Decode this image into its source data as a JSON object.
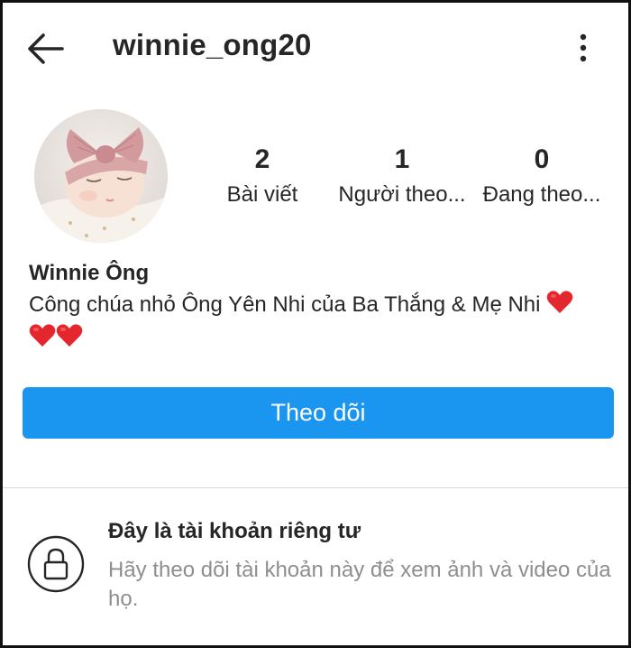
{
  "header": {
    "username": "winnie_ong20",
    "back_icon": "arrow-left-icon",
    "menu_icon": "more-vertical-icon"
  },
  "profile": {
    "avatar": "profile-photo-baby",
    "stats": [
      {
        "value": "2",
        "label": "Bài viết"
      },
      {
        "value": "1",
        "label": "Người theo..."
      },
      {
        "value": "0",
        "label": "Đang theo..."
      }
    ],
    "full_name": "Winnie Ông",
    "bio_text": "Công chúa nhỏ Ông Yên Nhi của Ba Thắng & Mẹ Nhi",
    "bio_emoji": "red-heart-icon"
  },
  "actions": {
    "follow_label": "Theo dõi",
    "follow_color": "#1a96f0"
  },
  "private_notice": {
    "icon": "lock-icon",
    "title": "Đây là tài khoản riêng tư",
    "description": "Hãy theo dõi tài khoản này để xem ảnh và video của họ."
  }
}
